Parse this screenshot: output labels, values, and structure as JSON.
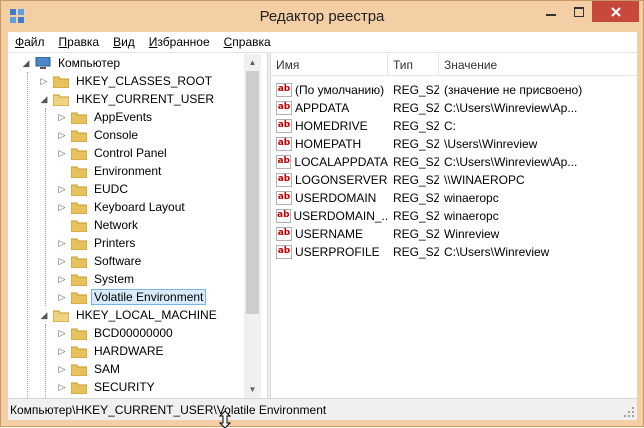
{
  "window": {
    "title": "Редактор реестра",
    "accent_color": "#f4cfa6",
    "close_color": "#c7493e"
  },
  "menu": [
    {
      "label": "Файл",
      "acc": "Ф",
      "rest": "айл"
    },
    {
      "label": "Правка",
      "acc": "П",
      "rest": "равка"
    },
    {
      "label": "Вид",
      "acc": "В",
      "rest": "ид"
    },
    {
      "label": "Избранное",
      "acc": "И",
      "rest": "збранное"
    },
    {
      "label": "Справка",
      "acc": "С",
      "rest": "правка"
    }
  ],
  "tree": {
    "root": "Компьютер",
    "hkcr": "HKEY_CLASSES_ROOT",
    "hkcu": "HKEY_CURRENT_USER",
    "hkcu_children": [
      "AppEvents",
      "Console",
      "Control Panel",
      "Environment",
      "EUDC",
      "Keyboard Layout",
      "Network",
      "Printers",
      "Software",
      "System",
      "Volatile Environment"
    ],
    "hklm": "HKEY_LOCAL_MACHINE",
    "hklm_children": [
      "BCD00000000",
      "HARDWARE",
      "SAM",
      "SECURITY"
    ],
    "selected": "Volatile Environment"
  },
  "list": {
    "columns": [
      "Имя",
      "Тип",
      "Значение"
    ],
    "rows": [
      {
        "name": "(По умолчанию)",
        "type": "REG_SZ",
        "value": "(значение не присвоено)"
      },
      {
        "name": "APPDATA",
        "type": "REG_SZ",
        "value": "C:\\Users\\Winreview\\Ap..."
      },
      {
        "name": "HOMEDRIVE",
        "type": "REG_SZ",
        "value": "C:"
      },
      {
        "name": "HOMEPATH",
        "type": "REG_SZ",
        "value": "\\Users\\Winreview"
      },
      {
        "name": "LOCALAPPDATA",
        "type": "REG_SZ",
        "value": "C:\\Users\\Winreview\\Ap..."
      },
      {
        "name": "LOGONSERVER",
        "type": "REG_SZ",
        "value": "\\\\WINAEROPC"
      },
      {
        "name": "USERDOMAIN",
        "type": "REG_SZ",
        "value": "winaeropc"
      },
      {
        "name": "USERDOMAIN_...",
        "type": "REG_SZ",
        "value": "winaeropc"
      },
      {
        "name": "USERNAME",
        "type": "REG_SZ",
        "value": "Winreview"
      },
      {
        "name": "USERPROFILE",
        "type": "REG_SZ",
        "value": "C:\\Users\\Winreview"
      }
    ]
  },
  "status": {
    "path": "Компьютер\\HKEY_CURRENT_USER\\Volatile Environment"
  },
  "icons": {
    "app": "registry-editor-icon",
    "folder": "folder-icon",
    "computer": "computer-icon",
    "string_value": "string-value-icon"
  }
}
